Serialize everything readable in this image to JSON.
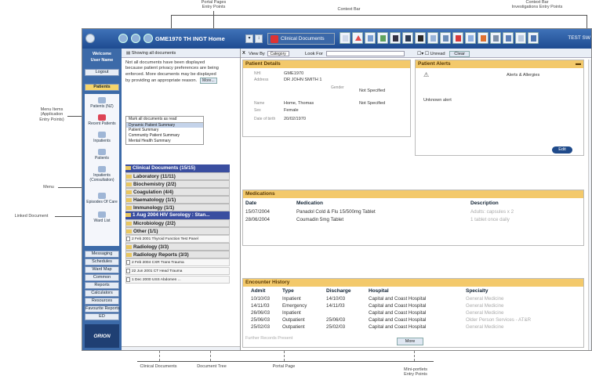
{
  "callouts": {
    "portal_pages_top": "Portal Pages\nEntry Points",
    "context_bar": "Context Bar",
    "context_bar_entry": "Context Bar\nInvestigations Entry Points",
    "menu_items": "Menu Items\n(Application\nEntry Points)",
    "menu": "Menu",
    "linked_document": "Linked Document",
    "clinical_documents": "Clinical Documents",
    "document_tree": "Document Tree",
    "portal_page": "Portal Page",
    "mini_portlets": "Mini-portlets\nEntry Points"
  },
  "toolbar": {
    "patient": "GME1970 TH INGT Home",
    "module": "Clinical Documents",
    "end_text": "TEST SW"
  },
  "sidebar": {
    "brand": "Welcome\nUser Name",
    "logout": "Logout",
    "patients_tab": "Patients",
    "items": [
      {
        "label": "Patients (NZ)"
      },
      {
        "label": "Recent Patients"
      },
      {
        "label": "Inpatients"
      },
      {
        "label": "Patients"
      },
      {
        "label": "Inpatients (Consultation)"
      },
      {
        "label": "Episodes Of Care"
      },
      {
        "label": "Ward List"
      }
    ],
    "menu_buttons": [
      "Messaging",
      "Schedules",
      "Ward Map",
      "Common",
      "Reports",
      "Calculators",
      "Resources",
      "Favourite Reports",
      "ED"
    ],
    "logo": "ORION"
  },
  "doc_panel": {
    "header": "Showing all documents",
    "message": "Not all documents have been displayed because patient privacy preferences are being enforced. More documents may be displayed by providing an appropriate reason.",
    "more_button": "More...",
    "menu": [
      "Mark all documents as read",
      "Dynamic Patient Summary",
      "Patient Summary",
      "Community Patient Summary",
      "Mental Health Summary"
    ],
    "tree": [
      {
        "label": "Clinical Documents (15/15)",
        "kind": "hl"
      },
      {
        "label": "Laboratory (11/11)",
        "kind": "cat"
      },
      {
        "label": "Biochemistry (2/2)",
        "kind": "cat"
      },
      {
        "label": "Coagulation (4/4)",
        "kind": "cat"
      },
      {
        "label": "Haematology (1/1)",
        "kind": "cat"
      },
      {
        "label": "Immunology (1/1)",
        "kind": "cat"
      },
      {
        "label": "1 Aug 2004 HIV Serology : Stan...",
        "kind": "hl"
      },
      {
        "label": "Microbiology (2/2)",
        "kind": "cat"
      },
      {
        "label": "Other (1/1)",
        "kind": "cat"
      },
      {
        "label": "2 Feb 2001 Thyroid Function Test Panel",
        "kind": "doc"
      },
      {
        "label": "Radiology (3/3)",
        "kind": "cat"
      },
      {
        "label": "Radiology Reports (3/3)",
        "kind": "cat"
      },
      {
        "label": "2 Feb 2004 CXR Trans Trauma",
        "kind": "doc"
      },
      {
        "label": "22 Jun 2001 CT Head Trauma",
        "kind": "doc"
      },
      {
        "label": "1 Dec 2000 USS Abdomen ...",
        "kind": "doc"
      }
    ]
  },
  "filter": {
    "x": "X",
    "view_by": "View By",
    "view_value": "Category",
    "look_for": "Look For",
    "unread": "Unread",
    "clear": "Clear"
  },
  "patient_details": {
    "title": "Patient Details",
    "rows": [
      {
        "label": "NHI",
        "value": "GME1970"
      },
      {
        "label": "Address",
        "value": "DR JOHN SMITH 1"
      },
      {
        "label": "Gender",
        "value": ""
      },
      {
        "label": "Name",
        "value": "Home, Thomas"
      },
      {
        "label": "Sex",
        "value": "Female"
      },
      {
        "label": "Date of birth",
        "value": "20/02/1970"
      }
    ],
    "not_specified_1": "Not Specified",
    "not_specified_2": "Not Specified"
  },
  "patient_alerts": {
    "title": "Patient Alerts",
    "allergies": "Alerts & Allergies",
    "unknown": "Unknown alert",
    "edit": "Edit"
  },
  "medications": {
    "title": "Medications",
    "headers": [
      "Date",
      "Medication",
      "Description"
    ],
    "rows": [
      {
        "date": "15/07/2004",
        "medication": "Panadol Cold & Flu 15/500mg Tablet",
        "desc": "Adults: capsules x 2"
      },
      {
        "date": "28/06/2004",
        "medication": "Coumadin 5mg Tablet",
        "desc": "1 tablet once daily"
      }
    ]
  },
  "encounters": {
    "title": "Encounter History",
    "headers": [
      "Admit",
      "Type",
      "Discharge",
      "Hospital",
      "Specialty"
    ],
    "rows": [
      {
        "admit": "10/10/03",
        "type": "Inpatient",
        "discharge": "14/10/03",
        "hospital": "Capital and Coast Hospital",
        "specialty": "General Medicine"
      },
      {
        "admit": "14/11/03",
        "type": "Emergency",
        "discharge": "14/11/03",
        "hospital": "Capital and Coast Hospital",
        "specialty": "General Medicine"
      },
      {
        "admit": "26/06/03",
        "type": "Inpatient",
        "discharge": "",
        "hospital": "Capital and Coast Hospital",
        "specialty": "General Medicine"
      },
      {
        "admit": "25/06/03",
        "type": "Outpatient",
        "discharge": "25/06/03",
        "hospital": "Capital and Coast Hospital",
        "specialty": "Older Person Services - AT&R"
      },
      {
        "admit": "25/02/03",
        "type": "Outpatient",
        "discharge": "25/02/03",
        "hospital": "Capital and Coast Hospital",
        "specialty": "General Medicine"
      }
    ],
    "footer": "Further Records Present",
    "more": "More"
  }
}
